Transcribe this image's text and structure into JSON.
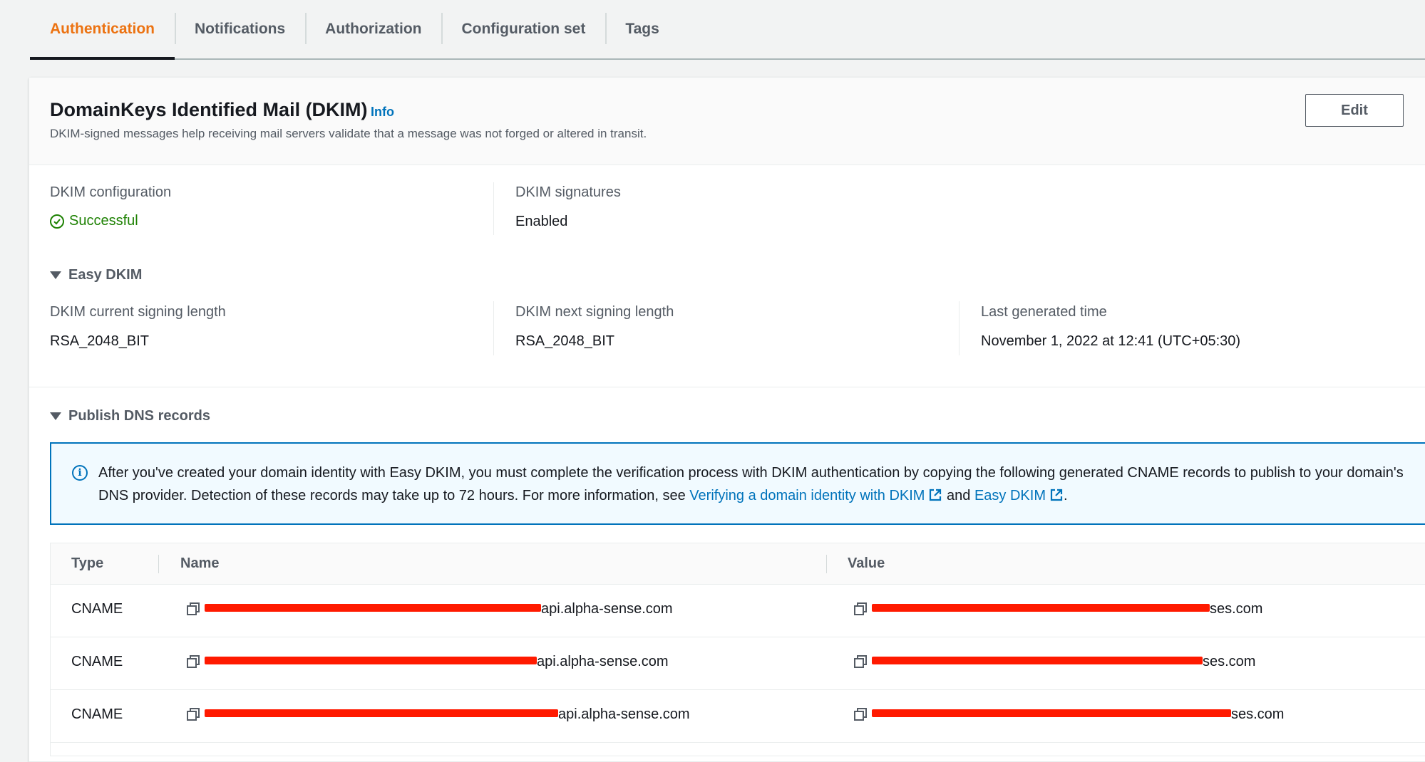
{
  "tabs": [
    {
      "label": "Authentication",
      "active": true
    },
    {
      "label": "Notifications",
      "active": false
    },
    {
      "label": "Authorization",
      "active": false
    },
    {
      "label": "Configuration set",
      "active": false
    },
    {
      "label": "Tags",
      "active": false
    }
  ],
  "panel": {
    "title": "DomainKeys Identified Mail (DKIM)",
    "info_label": "Info",
    "description": "DKIM-signed messages help receiving mail servers validate that a message was not forged or altered in transit.",
    "edit_label": "Edit"
  },
  "dkim": {
    "configuration_label": "DKIM configuration",
    "configuration_value": "Successful",
    "signatures_label": "DKIM signatures",
    "signatures_value": "Enabled"
  },
  "easy_dkim": {
    "section_label": "Easy DKIM",
    "current_length_label": "DKIM current signing length",
    "current_length_value": "RSA_2048_BIT",
    "next_length_label": "DKIM next signing length",
    "next_length_value": "RSA_2048_BIT",
    "last_generated_label": "Last generated time",
    "last_generated_value": "November 1, 2022 at 12:41 (UTC+05:30)"
  },
  "dns": {
    "section_label": "Publish DNS records",
    "alert_text_1": "After you've created your domain identity with Easy DKIM, you must complete the verification process with DKIM authentication by copying the following generated CNAME records to publish to your domain's DNS provider. Detection of these records may take up to 72 hours. For more information, see",
    "alert_link_1": "Verifying a domain identity with DKIM",
    "alert_and": "and",
    "alert_link_2": "Easy DKIM",
    "alert_end": ".",
    "columns": {
      "type": "Type",
      "name": "Name",
      "value": "Value"
    },
    "rows": [
      {
        "type": "CNAME",
        "name_suffix": "api.alpha-sense.com",
        "value_suffix": "ses.com"
      },
      {
        "type": "CNAME",
        "name_suffix": "api.alpha-sense.com",
        "value_suffix": "ses.com"
      },
      {
        "type": "CNAME",
        "name_suffix": "api.alpha-sense.com",
        "value_suffix": "ses.com"
      }
    ]
  },
  "colors": {
    "accent_active_tab": "#ec7211",
    "link": "#0073bb",
    "success": "#1d8102",
    "redaction": "#ff1a00"
  }
}
